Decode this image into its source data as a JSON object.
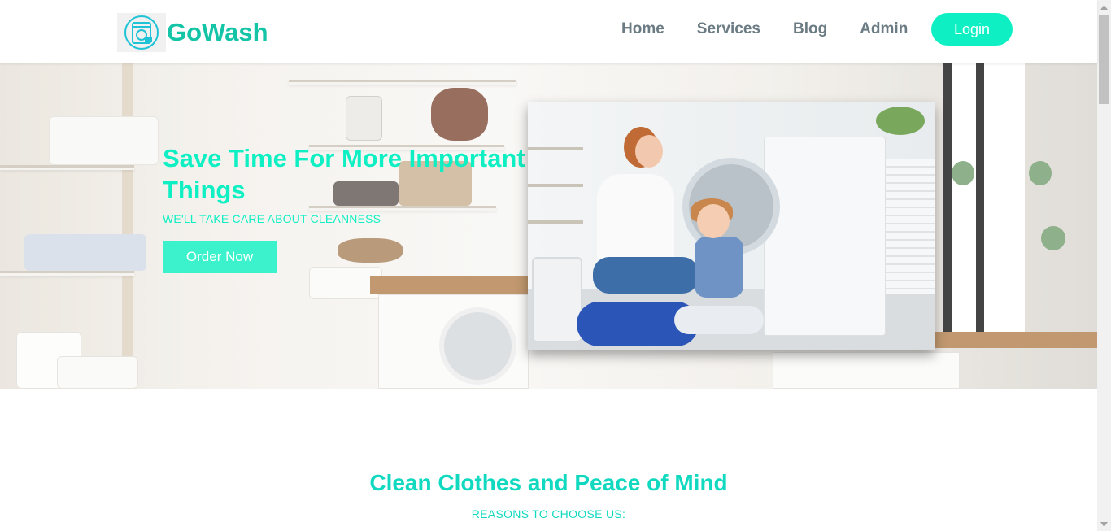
{
  "navbar": {
    "brand": "GoWash",
    "links": [
      {
        "label": "Home"
      },
      {
        "label": "Services"
      },
      {
        "label": "Blog"
      },
      {
        "label": "Admin"
      }
    ],
    "login_label": "Login"
  },
  "hero": {
    "title": "Save Time For More Important Things",
    "subtitle": "WE'LL TAKE CARE ABOUT CLEANNESS",
    "cta_label": "Order Now"
  },
  "section": {
    "title": "Clean Clothes and Peace of Mind",
    "subtitle": "REASONS TO CHOOSE US:"
  },
  "colors": {
    "accent": "#0ef0c3",
    "brand": "#14c4a6",
    "nav_text": "#6b7b83"
  },
  "icons": {
    "logo": "washing-machine-icon"
  }
}
